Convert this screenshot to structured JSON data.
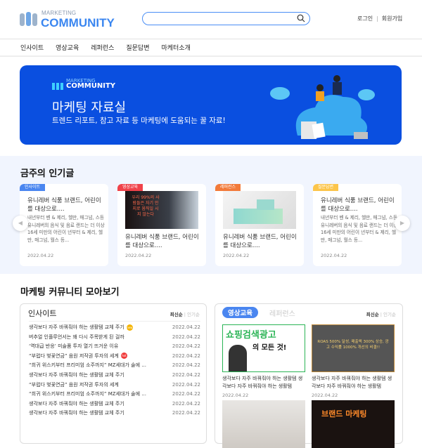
{
  "header": {
    "logo_sub": "MARKETING",
    "logo_main": "COMMUNITY",
    "search_placeholder": "",
    "login": "로그인",
    "signup": "회원가입"
  },
  "nav": [
    "인사이트",
    "영상교육",
    "레퍼런스",
    "질문답변",
    "마케터소개"
  ],
  "banner": {
    "logo_sub": "MARKETING",
    "logo_main": "COMMUNITY",
    "title": "마케팅 자료실",
    "subtitle": "트렌드 리포트, 참고 자료 등 마케팅에 도움되는 꿀 자료!"
  },
  "popular": {
    "title": "금주의 인기글",
    "cards": [
      {
        "tag": "인사이트",
        "tag_color": "#4a86f0",
        "title": "유니레버 식품 브랜드, 어린이를 대상으로....",
        "body": "내년부터 벤 & 제리, 헬만, 매그넘, 스등 유니레버의 음식 및 음료 랜드는 더 이상 16세 미만의 어린이 년부터 & 제리, 헬만, 매그넘, 월스 등...",
        "date": "2022.04.22"
      },
      {
        "tag": "영상교육",
        "tag_color": "#f0424a",
        "title": "유니레버 식품 브랜드, 어린이를 대상으로....",
        "thumb_text": "우리 99%의 사람들은 자기 인지로 움직일 시지 않는다",
        "date": "2022.04.22"
      },
      {
        "tag": "레퍼런스",
        "tag_color": "#f27a3a",
        "title": "유니레버 식품 브랜드, 어린이를 대상으로....",
        "date": "2022.04.22"
      },
      {
        "tag": "질문답변",
        "tag_color": "#fcc54a",
        "title": "유니레버 식품 브랜드, 어린이를 대상으로....",
        "body": "내년부터 벤 & 제리, 헬만, 매그넘, 스등 유니레버의 음식 및 음료 랜드는 더 이상 16세 미만의 어린이 년부터 & 제리, 헬만, 매그넘, 월스 등...",
        "date": "2022.04.22"
      }
    ]
  },
  "community": {
    "title": "마케팅 커뮤니티 모아보기",
    "insight": {
      "title": "인사이트",
      "sort_new": "최신순",
      "sort_pop": "인기순",
      "rows": [
        {
          "t": "생각보다 자주 바꿔줘야 하는 생활템 교체 주기",
          "d": "2022.04.22",
          "badge": "new"
        },
        {
          "t": "버추얼 인플루언서는 왜 다시 주목받게 된 걸까",
          "d": "2022.04.22"
        },
        {
          "t": "‘역대급 반응’ 미술품 투자 열기 뜨거운 이유",
          "d": "2022.04.22"
        },
        {
          "t": "“부럽다 벚꽃연금” 음원 저작권 투자의 세계",
          "d": "2022.04.22",
          "badge": "hot"
        },
        {
          "t": "“희귀 위스키부터 프리미엄 소주까지” MZ세대가 술에 ...",
          "d": "2022.04.22"
        },
        {
          "t": "생각보다 자주 바꿔줘야 하는 생활템 교체 주기",
          "d": "2022.04.22"
        },
        {
          "t": "“부럽다 벚꽃연금” 음원 저작권 투자의 세계",
          "d": "2022.04.22"
        },
        {
          "t": "“희귀 위스키부터 프리미엄 소주까지” MZ세대가 술에 ...",
          "d": "2022.04.22"
        },
        {
          "t": "생각보다 자주 바꿔줘야 하는 생활템 교체 주기",
          "d": "2022.04.22"
        },
        {
          "t": "생각보다 자주 바꿔줘야 하는 생활템 교체 주기",
          "d": "2022.04.22"
        }
      ]
    },
    "video": {
      "tab_active": "영상교육",
      "tab_inactive": "레퍼런스",
      "sort_new": "최신순",
      "sort_pop": "인기순",
      "items": [
        {
          "thumb_title": "쇼핑검색광고",
          "thumb_sub": "의 모든 것!",
          "title": "생각보다 자주 바꿔줘야 하는 생활템 생각보다 자주 바꿔줘야 하는 생활템",
          "date": "2022.04.22"
        },
        {
          "thumb_title": "ROAS 500% 달성, 매출액 300% 상승, 광고 수익률 1000% 개선의 비결!!",
          "title": "생각보다 자주 바꿔줘야 하는 생활템 생각보다 자주 바꿔줘야 하는 생활템",
          "date": "2022.04.22"
        },
        {
          "title": "",
          "date": ""
        },
        {
          "thumb_title": "브랜드 마케팅",
          "title": "",
          "date": ""
        }
      ]
    }
  },
  "colors": {
    "accent": "#3a86f0",
    "banner": "#0a4fe0"
  }
}
